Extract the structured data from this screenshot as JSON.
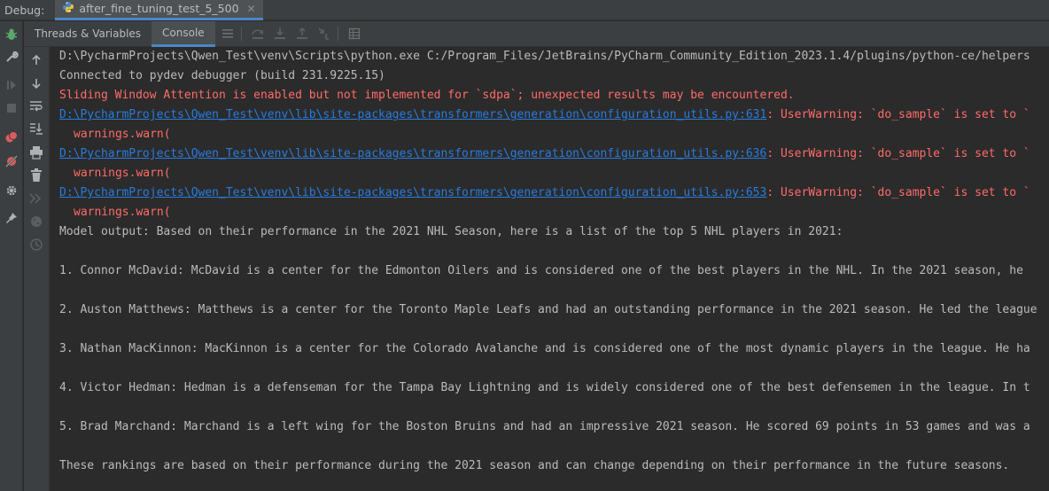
{
  "topbar": {
    "debug_label": "Debug:",
    "run_tab_label": "after_fine_tuning_test_5_500"
  },
  "tabs": {
    "threads_label": "Threads & Variables",
    "console_label": "Console"
  },
  "console": {
    "cmd_line": "D:\\PycharmProjects\\Qwen_Test\\venv\\Scripts\\python.exe C:/Program_Files/JetBrains/PyCharm_Community_Edition_2023.1.4/plugins/python-ce/helpers",
    "connected_line": "Connected to pydev debugger (build 231.9225.15)",
    "sliding_warning": "Sliding Window Attention is enabled but not implemented for `sdpa`; unexpected results may be encountered.",
    "warnings": [
      {
        "path": "D:\\PycharmProjects\\Qwen_Test\\venv\\lib\\site-packages\\transformers\\generation\\configuration_utils.py:631",
        "message": ": UserWarning: `do_sample` is set to `",
        "warn_call": "warnings.warn("
      },
      {
        "path": "D:\\PycharmProjects\\Qwen_Test\\venv\\lib\\site-packages\\transformers\\generation\\configuration_utils.py:636",
        "message": ": UserWarning: `do_sample` is set to `",
        "warn_call": "warnings.warn("
      },
      {
        "path": "D:\\PycharmProjects\\Qwen_Test\\venv\\lib\\site-packages\\transformers\\generation\\configuration_utils.py:653",
        "message": ": UserWarning: `do_sample` is set to `",
        "warn_call": "warnings.warn("
      }
    ],
    "model_output_line": "Model output: Based on their performance in the 2021 NHL Season, here is a list of the top 5 NHL players in 2021:",
    "items": [
      "1. Connor McDavid: McDavid is a center for the Edmonton Oilers and is considered one of the best players in the NHL. In the 2021 season, he",
      "2. Auston Matthews: Matthews is a center for the Toronto Maple Leafs and had an outstanding performance in the 2021 season. He led the league",
      "3. Nathan MacKinnon: MacKinnon is a center for the Colorado Avalanche and is considered one of the most dynamic players in the league. He ha",
      "4. Victor Hedman: Hedman is a defenseman for the Tampa Bay Lightning and is widely considered one of the best defensemen in the league. In t",
      "5. Brad Marchand: Marchand is a left wing for the Boston Bruins and had an impressive 2021 season. He scored 69 points in 53 games and was a"
    ],
    "closing_line": "These rankings are based on their performance during the 2021 season and can change depending on their performance in the future seasons."
  },
  "colors": {
    "background": "#2b2b2b",
    "panel": "#3c3f41",
    "text": "#bbbbbb",
    "error": "#ff6b68",
    "link": "#287bde",
    "accent": "#4a88c7"
  },
  "icons": {
    "run_tab": "python-icon",
    "left_toolbar": [
      "debug-bug-icon",
      "wrench-icon",
      "resume-icon",
      "stop-icon",
      "view-breakpoints-icon",
      "mute-breakpoints-icon",
      "settings-icon",
      "pin-icon"
    ],
    "console_toolbar": [
      "up-arrow-icon",
      "down-arrow-icon",
      "soft-wrap-icon",
      "scroll-to-end-icon",
      "print-icon",
      "trash-icon",
      "resume-program-icon",
      "python-console-icon",
      "history-icon"
    ],
    "tab_toolbar": [
      "menu-icon",
      "step-over-icon",
      "step-into-icon",
      "step-out-icon",
      "run-to-cursor-icon",
      "evaluate-table-icon"
    ]
  }
}
